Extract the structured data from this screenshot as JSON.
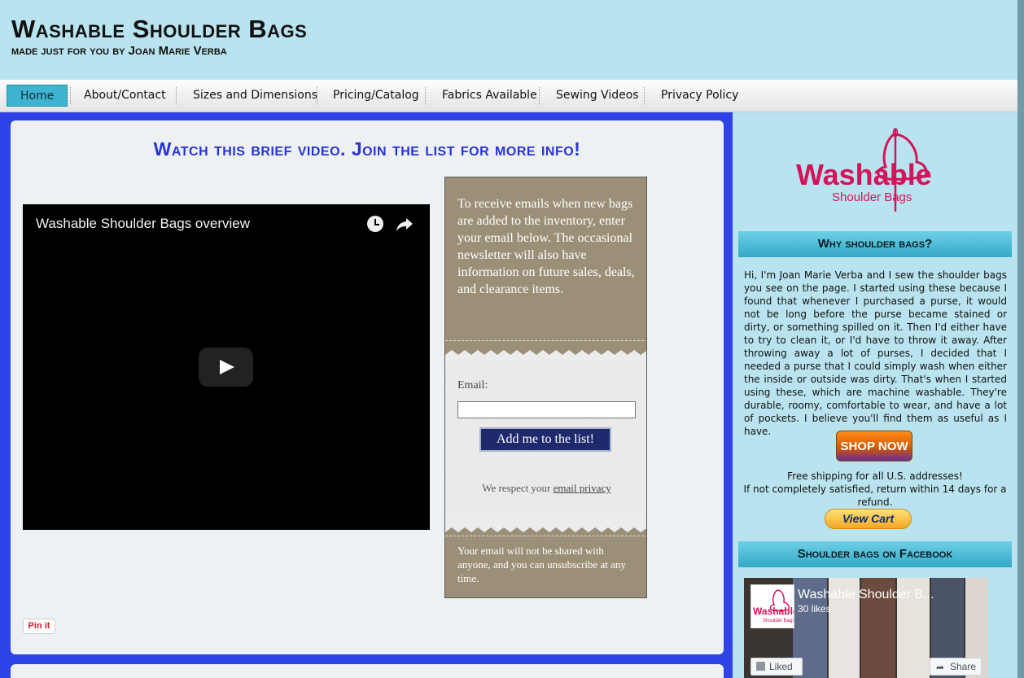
{
  "header": {
    "title": "Washable Shoulder Bags",
    "subtitle": "made just for you by Joan Marie Verba"
  },
  "nav": {
    "items": [
      {
        "label": "Home",
        "active": true
      },
      {
        "label": "About/Contact"
      },
      {
        "label": "Sizes and Dimensions"
      },
      {
        "label": "Pricing/Catalog"
      },
      {
        "label": "Fabrics Available"
      },
      {
        "label": "Sewing Videos"
      },
      {
        "label": "Privacy Policy"
      }
    ]
  },
  "main": {
    "video_heading": "Watch this brief video. Join the list for more info!",
    "video": {
      "title": "Washable Shoulder Bags overview",
      "icons": [
        "clock-icon",
        "share-icon",
        "play-icon"
      ]
    },
    "signup": {
      "intro": "To receive emails when new bags are added to the inventory, enter your email below. The occasional newsletter will also have information on future sales, deals, and clearance items.",
      "email_label": "Email:",
      "email_value": "",
      "button_label": "Add me to the list!",
      "privacy_prefix": "We respect your",
      "privacy_link": "email privacy",
      "footer": "Your email will not be shared with anyone, and you can unsubscribe at any time."
    },
    "pinit_label": "Pin it"
  },
  "sidebar": {
    "logo": {
      "line1": "Washable",
      "line2": "Shoulder Bags"
    },
    "why_heading": "Why shoulder bags?",
    "why_text": "Hi, I'm Joan Marie Verba and I sew the shoulder bags you see on the page. I started using these because I found that whenever I purchased a purse, it would not be long before the purse became stained or dirty, or something spilled on it. Then I'd either have to try to clean it, or I'd have to throw it away. After throwing away a lot of purses, I decided that I needed a purse that I could simply wash when either the inside or outside was dirty. That's when I started using these, which are machine washable. They're durable, roomy, comfortable to wear, and have a lot of pockets. I believe you'll find them as useful as I have.",
    "shop_now": "SHOP NOW",
    "shipping_line1": "Free shipping for all U.S. addresses!",
    "shipping_line2": "If not completely satisfied, return within 14 days for a refund.",
    "view_cart": "View Cart",
    "facebook_heading": "Shoulder bags on Facebook",
    "facebook": {
      "page_name": "Washable Shoulder B...",
      "likes": "30 likes",
      "liked_label": "Liked",
      "share_label": "Share"
    }
  },
  "colors": {
    "header_bg": "#b9e3ee",
    "main_border": "#2e43e8",
    "heading_blue": "#2833d6",
    "nav_active": "#3fb3cf",
    "sidebar_head": "#33a9c8",
    "logo_pink": "#d4145a"
  }
}
